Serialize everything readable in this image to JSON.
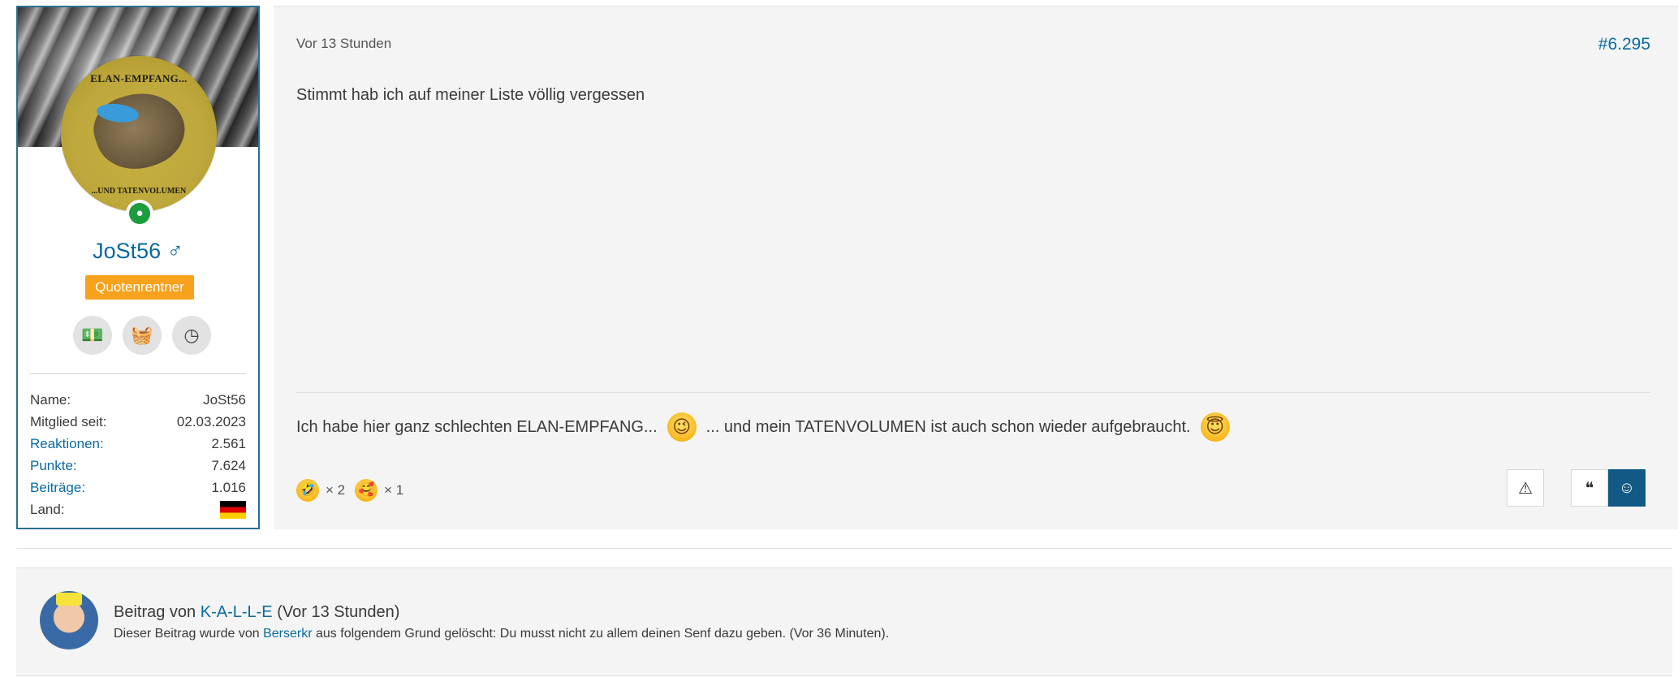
{
  "user": {
    "avatar_top_text": "ELAN-EMPFANG...",
    "avatar_bottom_text": "...UND TATENVOLUMEN",
    "name": "JoSt56",
    "gender_symbol": "♂",
    "title": "Quotenrentner",
    "trophy_icons": [
      "money-icon",
      "basket-icon",
      "clock-icon"
    ],
    "online_icon": "user-online-icon",
    "stats": [
      {
        "key": "Name:",
        "value": "JoSt56",
        "link": false
      },
      {
        "key": "Mitglied seit:",
        "value": "02.03.2023",
        "link": false
      },
      {
        "key": "Reaktionen:",
        "value": "2.561",
        "link": true
      },
      {
        "key": "Punkte:",
        "value": "7.624",
        "link": true
      },
      {
        "key": "Beiträge:",
        "value": "1.016",
        "link": true
      }
    ],
    "country_label": "Land:",
    "country_flag": "germany-flag"
  },
  "post": {
    "date": "Vor 13 Stunden",
    "number": "#6.295",
    "body": "Stimmt hab ich auf meiner Liste völlig vergessen",
    "signature_part1": "Ich habe hier ganz schlechten ELAN-EMPFANG...",
    "signature_part2": "... und mein TATENVOLUMEN ist auch schon wieder aufgebraucht.",
    "reactions": [
      {
        "icon": "laughing-emoji-icon",
        "count": "× 2"
      },
      {
        "icon": "love-emoji-icon",
        "count": "× 1"
      }
    ],
    "buttons": {
      "report_icon": "warning-icon",
      "quote_icon": "quote-icon",
      "react_icon": "smile-icon"
    }
  },
  "deleted_post": {
    "prefix": "Beitrag von",
    "author": "K-A-L-L-E",
    "time": "(Vor 13 Stunden)",
    "reason_prefix": "Dieser Beitrag wurde von",
    "moderator": "Berserkr",
    "reason_suffix": "aus folgendem Grund gelöscht: Du musst nicht zu allem deinen Senf dazu geben. (Vor 36 Minuten)."
  },
  "colors": {
    "link": "#0a6aa1",
    "title_badge": "#f7a21c",
    "react_button": "#125a85",
    "online": "#1f9c3d"
  }
}
